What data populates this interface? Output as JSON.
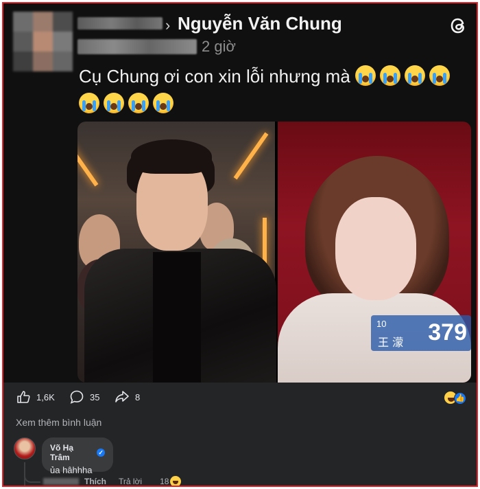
{
  "post": {
    "target_name": "Nguyễn Văn Chung",
    "time": "2 giờ",
    "text": "Cụ Chung ơi con xin lỗi nhưng mà",
    "emoji_count_line1": 4,
    "emoji_count_line2": 4,
    "emoji_icon": "loudly-crying-face-icon"
  },
  "photo_right": {
    "rank": "10",
    "contestant_name": "王 濛",
    "score": "379"
  },
  "actions": {
    "likes": "1,6K",
    "comments": "35",
    "shares": "8"
  },
  "comments": {
    "see_more": "Xem thêm bình luận",
    "items": [
      {
        "author": "Võ Hạ Trâm",
        "text": "ủa hâhhha",
        "like_label": "Thích",
        "reply_label": "Trả lời",
        "reaction_count": "18"
      }
    ]
  },
  "colors": {
    "frame_border": "#e1232b",
    "post_bg": "#101010",
    "actions_bg": "#242526",
    "bubble_bg": "#3a3b3c",
    "accent": "#1877f2"
  }
}
